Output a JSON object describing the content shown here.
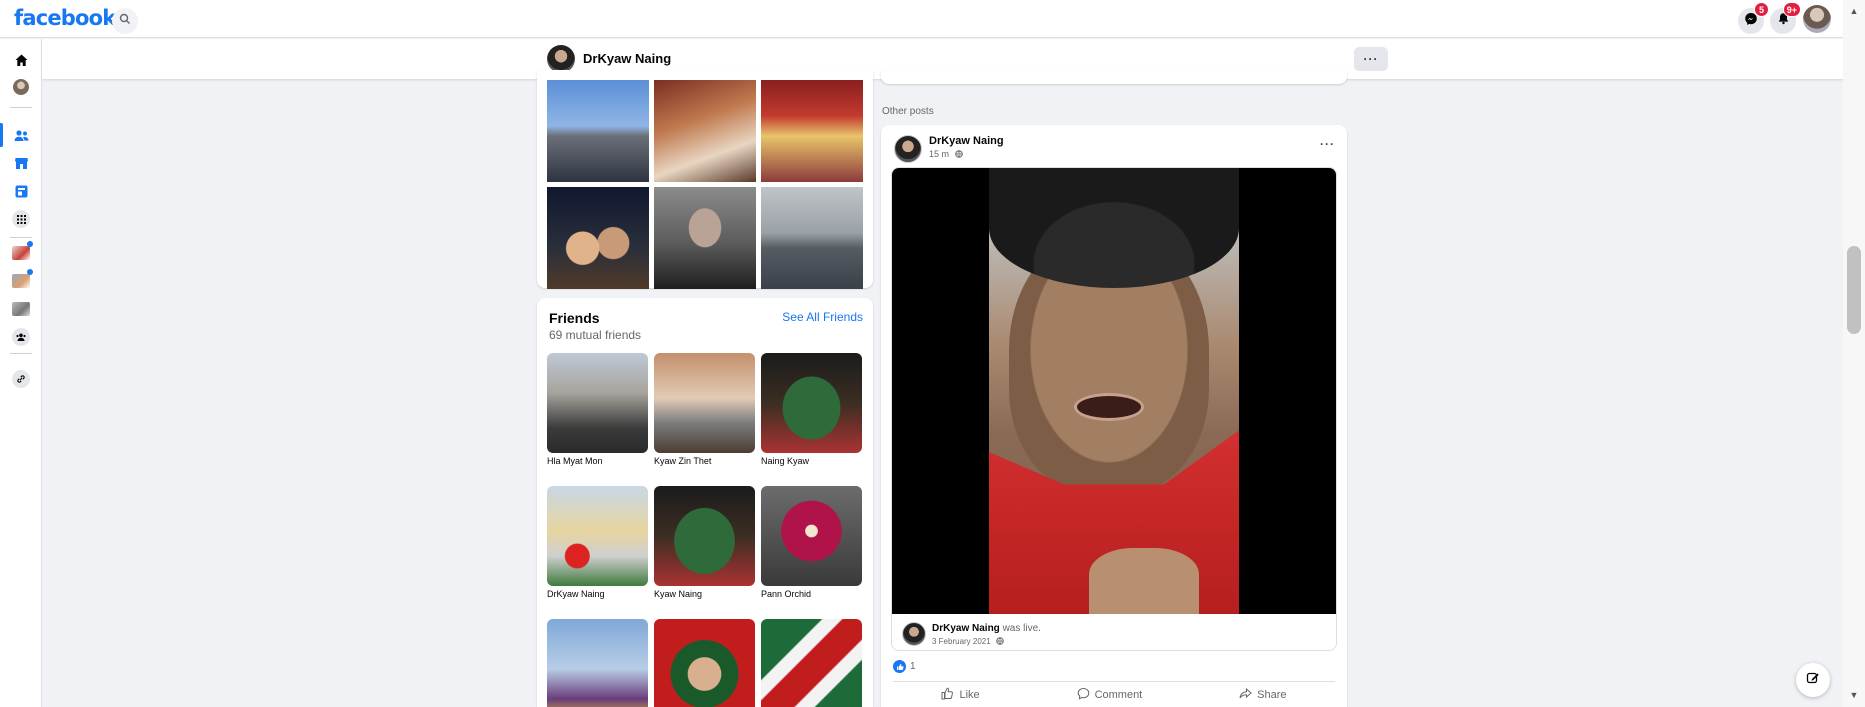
{
  "app": {
    "logo": "facebook"
  },
  "topbar": {
    "messenger_badge": "5",
    "notifications_badge": "9+"
  },
  "profile": {
    "name": "DrKyaw Naing",
    "more_label": "···"
  },
  "friends": {
    "title": "Friends",
    "mutual": "69 mutual friends",
    "see_all": "See All Friends",
    "items": [
      {
        "name": "Hla Myat Mon"
      },
      {
        "name": "Kyaw Zin Thet"
      },
      {
        "name": "Naing Kyaw"
      },
      {
        "name": "DrKyaw Naing"
      },
      {
        "name": "Kyaw Naing"
      },
      {
        "name": "Pann Orchid"
      },
      {
        "name": ""
      },
      {
        "name": ""
      },
      {
        "name": ""
      }
    ]
  },
  "feed": {
    "other_posts_label": "Other posts",
    "post": {
      "author": "DrKyaw Naing",
      "time": "15 m",
      "more_label": "···",
      "live_author": "DrKyaw Naing",
      "live_suffix": "was live.",
      "live_date": "3 February 2021",
      "reaction_count": "1",
      "actions": {
        "like": "Like",
        "comment": "Comment",
        "share": "Share"
      }
    }
  },
  "colors": {
    "brand": "#1877f2",
    "badge": "#e41e3f",
    "background": "#f0f2f5"
  }
}
